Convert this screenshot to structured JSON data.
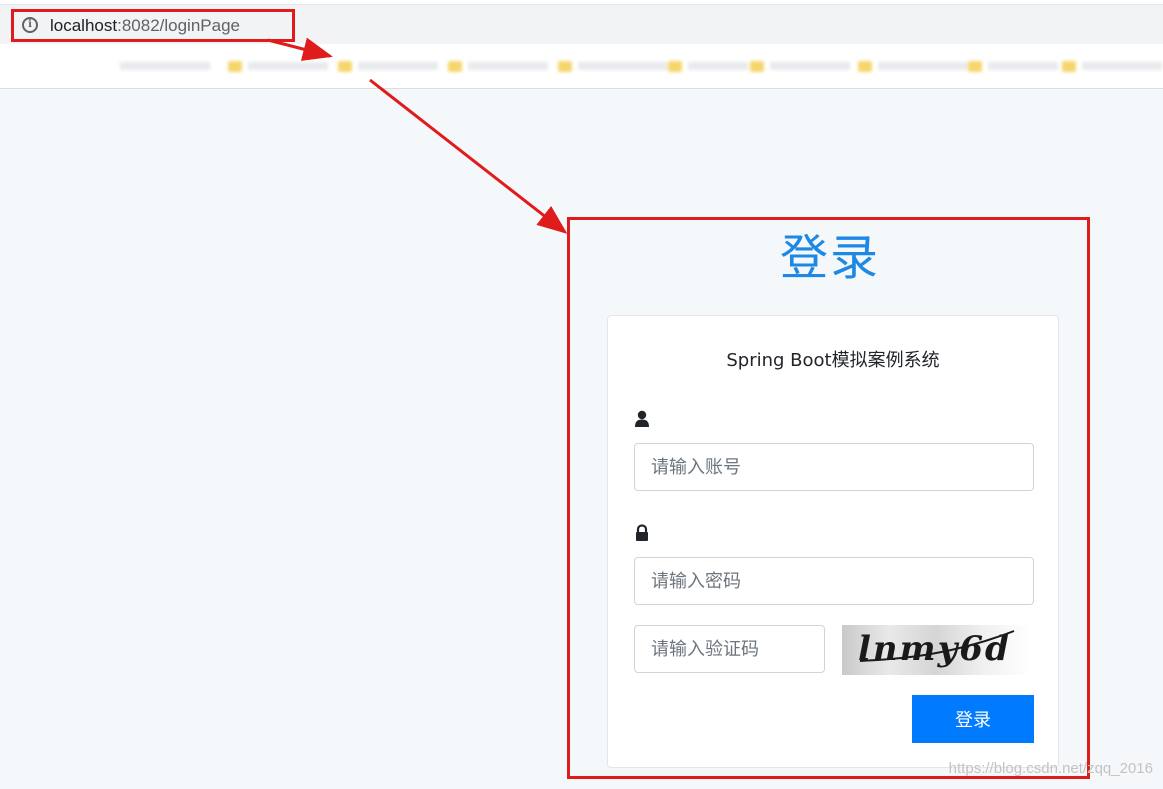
{
  "browser": {
    "url_host": "localhost",
    "url_path": ":8082/loginPage"
  },
  "login": {
    "title": "登录",
    "heading": "Spring Boot模拟案例系统",
    "username_placeholder": "请输入账号",
    "password_placeholder": "请输入密码",
    "captcha_placeholder": "请输入验证码",
    "captcha_text": "lnmy6d",
    "submit_label": "登录"
  },
  "watermark": "https://blog.csdn.net/zqq_2016",
  "colors": {
    "accent": "#007bff",
    "title": "#1e88e5",
    "annotation": "#e01b1b"
  }
}
